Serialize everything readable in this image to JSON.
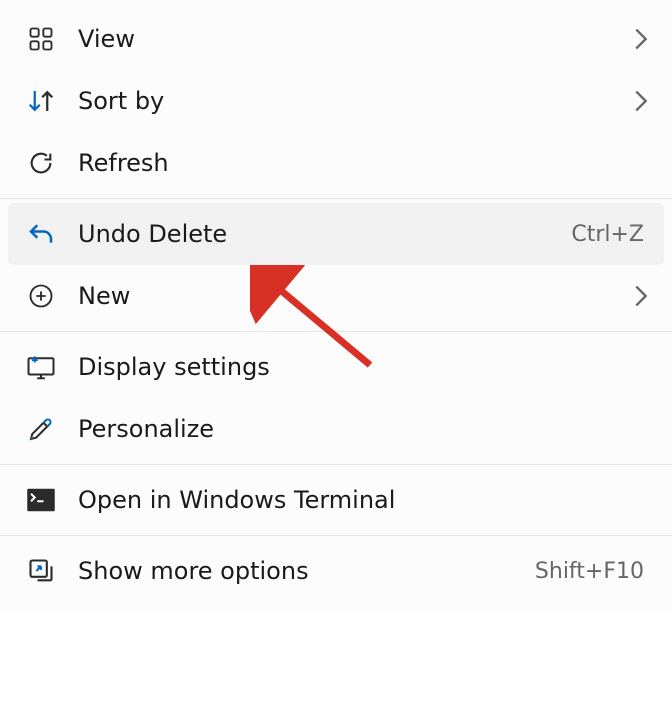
{
  "menu": {
    "items": [
      {
        "label": "View",
        "shortcut": "",
        "has_submenu": true
      },
      {
        "label": "Sort by",
        "shortcut": "",
        "has_submenu": true
      },
      {
        "label": "Refresh",
        "shortcut": "",
        "has_submenu": false
      },
      {
        "label": "Undo Delete",
        "shortcut": "Ctrl+Z",
        "has_submenu": false
      },
      {
        "label": "New",
        "shortcut": "",
        "has_submenu": true
      },
      {
        "label": "Display settings",
        "shortcut": "",
        "has_submenu": false
      },
      {
        "label": "Personalize",
        "shortcut": "",
        "has_submenu": false
      },
      {
        "label": "Open in Windows Terminal",
        "shortcut": "",
        "has_submenu": false
      },
      {
        "label": "Show more options",
        "shortcut": "Shift+F10",
        "has_submenu": false
      }
    ]
  },
  "colors": {
    "accent_blue": "#0067c0",
    "icon_dark": "#2b2b2b",
    "arrow_red": "#d93025"
  }
}
